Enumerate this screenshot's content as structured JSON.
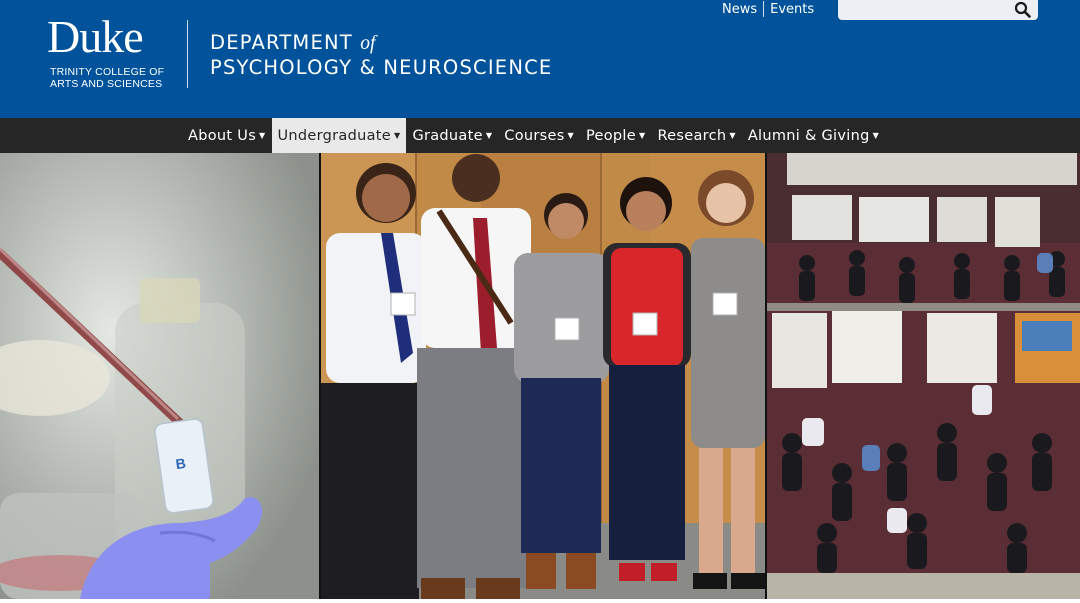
{
  "header": {
    "logo_wordmark": "Duke",
    "logo_line1": "TRINITY COLLEGE OF",
    "logo_line2": "ARTS AND SCIENCES",
    "dept_line1_a": "DEPARTMENT ",
    "dept_line1_of": "of",
    "dept_line2": "PSYCHOLOGY & NEUROSCIENCE",
    "background_color": "#00539b"
  },
  "utility": {
    "links": [
      "News",
      "Events"
    ],
    "search": {
      "placeholder": "",
      "icon": "search-icon"
    }
  },
  "nav": {
    "items": [
      {
        "label": "About Us",
        "active": false
      },
      {
        "label": "Undergraduate",
        "active": true
      },
      {
        "label": "Graduate",
        "active": false
      },
      {
        "label": "Courses",
        "active": false
      },
      {
        "label": "People",
        "active": false
      },
      {
        "label": "Research",
        "active": false
      },
      {
        "label": "Alumni & Giving",
        "active": false
      }
    ],
    "caret_icon": "caret-down-icon",
    "background_color": "#262626",
    "active_background": "#e9e9e9"
  },
  "hero": {
    "panels": [
      {
        "subject": "lab-pipette"
      },
      {
        "subject": "student-group"
      },
      {
        "subject": "poster-session"
      }
    ]
  }
}
